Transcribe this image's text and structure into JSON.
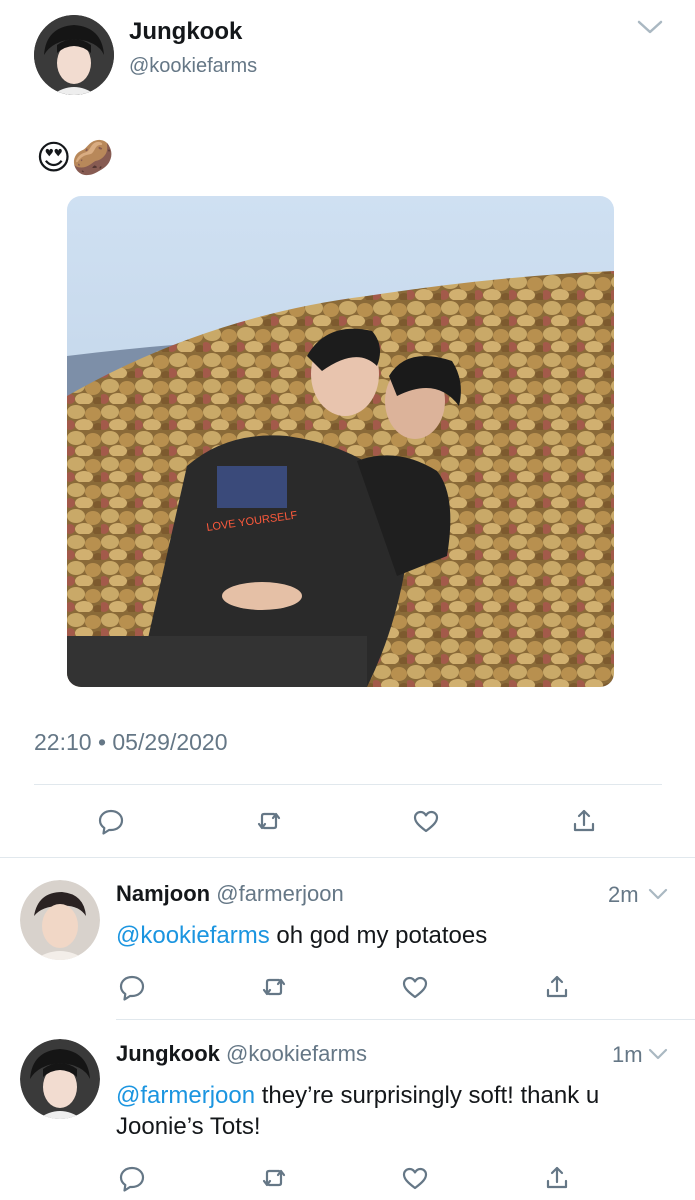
{
  "main_tweet": {
    "name": "Jungkook",
    "handle": "@kookiefarms",
    "emojis": [
      "😍",
      "🥔"
    ],
    "timestamp": "22:10 • 05/29/2020",
    "photo": {
      "jacket_text": "LOVE YOURSELF"
    }
  },
  "replies": [
    {
      "name": "Namjoon",
      "handle": "@farmerjoon",
      "time": "2m",
      "mention": "@kookiefarms",
      "text": " oh god my potatoes"
    },
    {
      "name": "Jungkook",
      "handle": "@kookiefarms",
      "time": "1m",
      "mention": "@farmerjoon",
      "text": " they’re surprisingly soft! thank u Joonie’s Tots!"
    }
  ],
  "icons": [
    "chevron-down-icon",
    "reply-icon",
    "retweet-icon",
    "like-icon",
    "share-icon"
  ],
  "colors": {
    "link": "#1b95e0",
    "muted": "#657786",
    "divider": "#e1e8ed",
    "icon": "#657786"
  }
}
